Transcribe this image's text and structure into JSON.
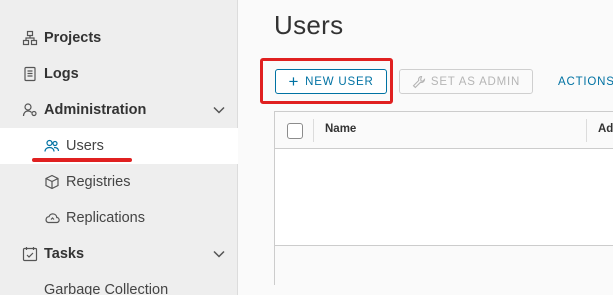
{
  "sidebar": {
    "items": [
      {
        "label": "Projects",
        "icon": "projects-icon"
      },
      {
        "label": "Logs",
        "icon": "logs-icon"
      },
      {
        "label": "Administration",
        "icon": "administration-icon",
        "expanded": true
      },
      {
        "label": "Users",
        "icon": "users-icon",
        "active": true
      },
      {
        "label": "Registries",
        "icon": "registries-icon"
      },
      {
        "label": "Replications",
        "icon": "replications-icon"
      },
      {
        "label": "Tasks",
        "icon": "tasks-icon",
        "expanded": true
      },
      {
        "label": "Garbage Collection"
      }
    ]
  },
  "main": {
    "title": "Users",
    "toolbar": {
      "new_user_label": "NEW USER",
      "set_admin_label": "SET AS ADMIN",
      "actions_label": "ACTIONS"
    },
    "grid": {
      "columns": [
        "Name",
        "Ad"
      ]
    }
  },
  "colors": {
    "accent": "#0072a3",
    "highlight": "#e02020",
    "sidebar_bg": "#eeeeee"
  }
}
